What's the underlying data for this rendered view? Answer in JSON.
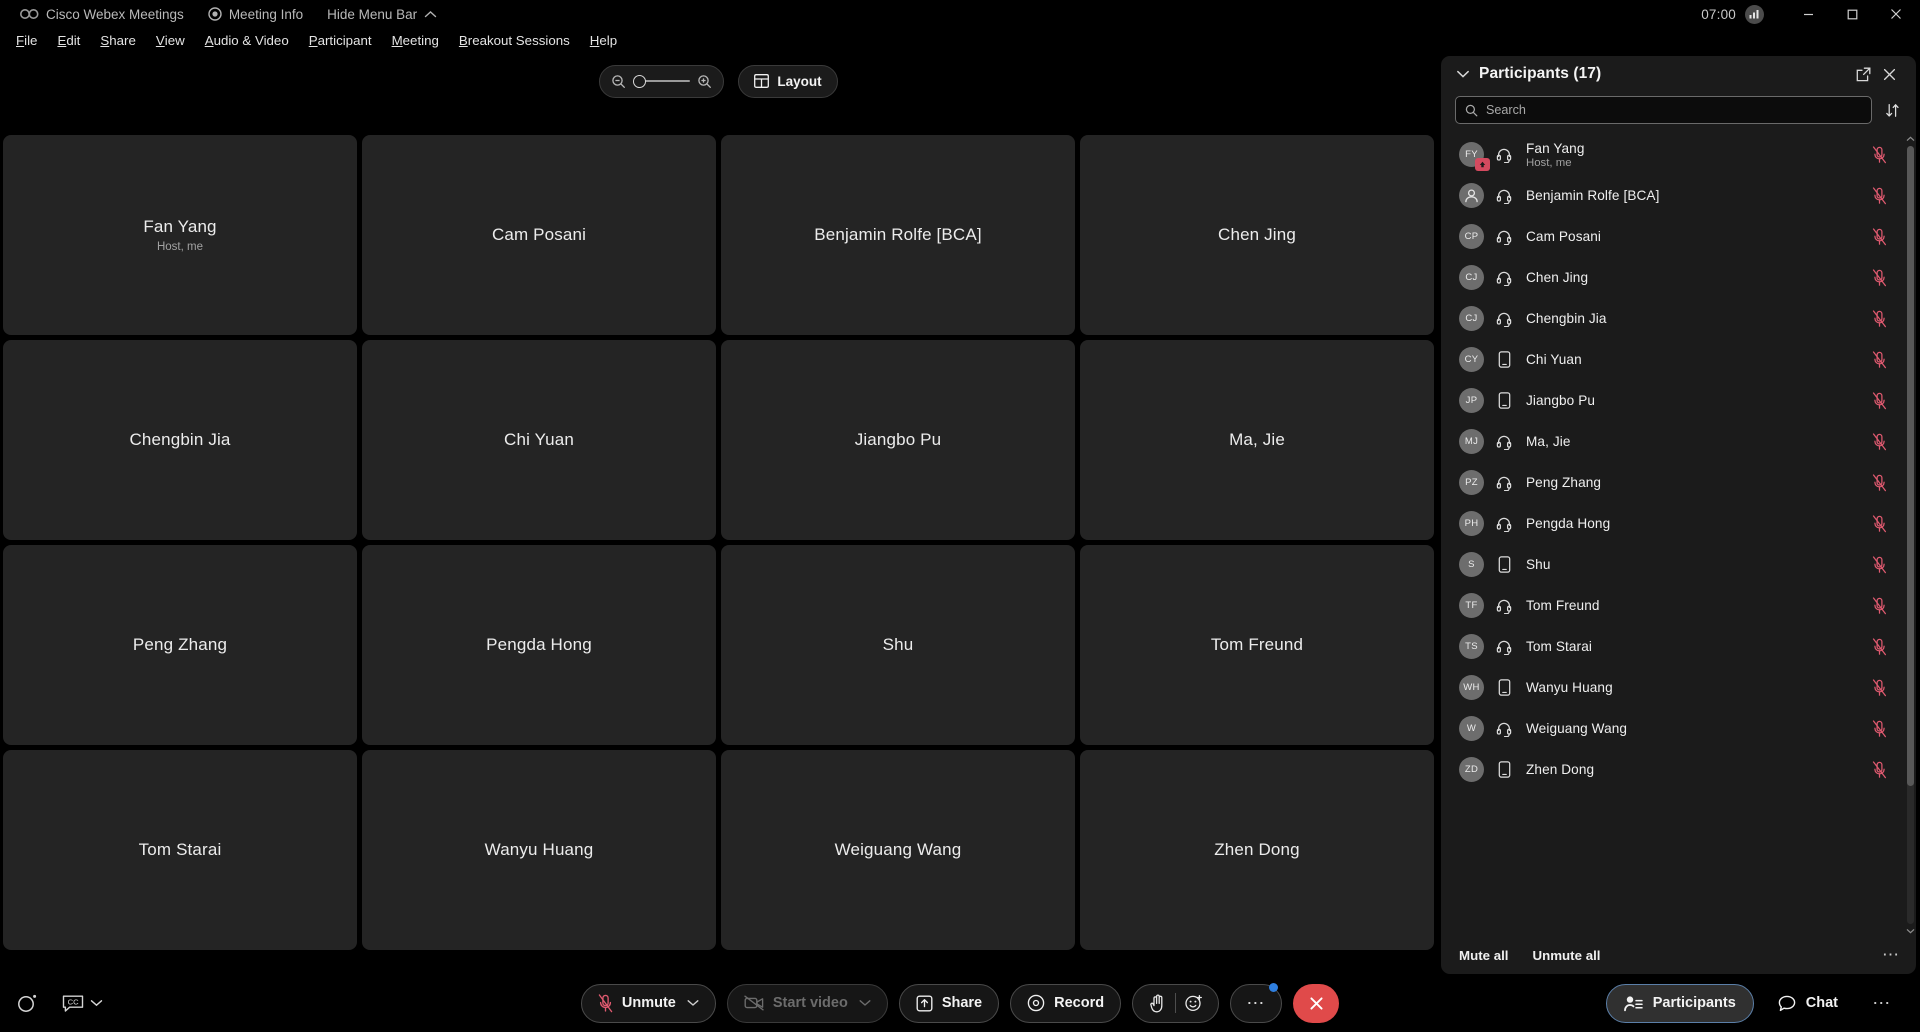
{
  "titlebar": {
    "app_name": "Cisco Webex Meetings",
    "meeting_info": "Meeting Info",
    "hide_menu_bar": "Hide Menu Bar",
    "clock": "07:00",
    "logo_icon": "webex-logo-icon",
    "meeting_info_icon": "info-shield-icon",
    "hide_menu_chevron_icon": "chevron-up-icon",
    "network_icon": "signal-bars-icon",
    "minimize_icon": "minimize-icon",
    "maximize_icon": "maximize-icon",
    "close_icon": "close-icon"
  },
  "menubar": {
    "items": [
      {
        "label": "File",
        "accesskey": "F"
      },
      {
        "label": "Edit",
        "accesskey": "E"
      },
      {
        "label": "Share",
        "accesskey": "S"
      },
      {
        "label": "View",
        "accesskey": "V"
      },
      {
        "label": "Audio & Video",
        "accesskey": "A"
      },
      {
        "label": "Participant",
        "accesskey": "P"
      },
      {
        "label": "Meeting",
        "accesskey": "M"
      },
      {
        "label": "Breakout Sessions",
        "accesskey": "B"
      },
      {
        "label": "Help",
        "accesskey": "H"
      }
    ]
  },
  "stage_top": {
    "zoom_out_icon": "zoom-out-icon",
    "zoom_in_icon": "zoom-in-icon",
    "zoom_level_percent": 0,
    "layout_label": "Layout",
    "layout_icon": "grid-layout-icon"
  },
  "grid": {
    "tiles": [
      {
        "name": "Fan Yang",
        "sub": "Host, me"
      },
      {
        "name": "Cam Posani",
        "sub": ""
      },
      {
        "name": "Benjamin Rolfe [BCA]",
        "sub": ""
      },
      {
        "name": "Chen Jing",
        "sub": ""
      },
      {
        "name": "Chengbin Jia",
        "sub": ""
      },
      {
        "name": "Chi Yuan",
        "sub": ""
      },
      {
        "name": "Jiangbo Pu",
        "sub": ""
      },
      {
        "name": "Ma, Jie",
        "sub": ""
      },
      {
        "name": "Peng Zhang",
        "sub": ""
      },
      {
        "name": "Pengda Hong",
        "sub": ""
      },
      {
        "name": "Shu",
        "sub": ""
      },
      {
        "name": "Tom Freund",
        "sub": ""
      },
      {
        "name": "Tom Starai",
        "sub": ""
      },
      {
        "name": "Wanyu Huang",
        "sub": ""
      },
      {
        "name": "Weiguang Wang",
        "sub": ""
      },
      {
        "name": "Zhen Dong",
        "sub": ""
      }
    ]
  },
  "panel": {
    "title": "Participants (17)",
    "collapse_icon": "chevron-down-icon",
    "popout_icon": "open-in-new-window-icon",
    "close_icon": "close-icon",
    "search": {
      "placeholder": "Search",
      "value": "",
      "icon": "search-icon"
    },
    "sort_icon": "sort-arrows-icon",
    "mute_all_label": "Mute all",
    "unmute_all_label": "Unmute all",
    "more_icon": "more-horizontal-icon",
    "scroll_up_icon": "chevron-up-icon",
    "scroll_down_icon": "chevron-down-icon",
    "participants": [
      {
        "initials": "FY",
        "name": "Fan Yang",
        "sub": "Host, me",
        "device": "headset",
        "muted": true,
        "host": true
      },
      {
        "initials": "",
        "name": "Benjamin Rolfe [BCA]",
        "sub": "",
        "device": "headset",
        "muted": true,
        "host": false,
        "avatar_icon": "person-icon"
      },
      {
        "initials": "CP",
        "name": "Cam Posani",
        "sub": "",
        "device": "headset",
        "muted": true,
        "host": false
      },
      {
        "initials": "CJ",
        "name": "Chen Jing",
        "sub": "",
        "device": "headset",
        "muted": true,
        "host": false
      },
      {
        "initials": "CJ",
        "name": "Chengbin Jia",
        "sub": "",
        "device": "headset",
        "muted": true,
        "host": false
      },
      {
        "initials": "CY",
        "name": "Chi Yuan",
        "sub": "",
        "device": "mobile",
        "muted": true,
        "host": false
      },
      {
        "initials": "JP",
        "name": "Jiangbo Pu",
        "sub": "",
        "device": "mobile",
        "muted": true,
        "host": false
      },
      {
        "initials": "MJ",
        "name": "Ma, Jie",
        "sub": "",
        "device": "headset",
        "muted": true,
        "host": false
      },
      {
        "initials": "PZ",
        "name": "Peng Zhang",
        "sub": "",
        "device": "headset",
        "muted": true,
        "host": false
      },
      {
        "initials": "PH",
        "name": "Pengda Hong",
        "sub": "",
        "device": "headset",
        "muted": true,
        "host": false
      },
      {
        "initials": "S",
        "name": "Shu",
        "sub": "",
        "device": "mobile",
        "muted": true,
        "host": false
      },
      {
        "initials": "TF",
        "name": "Tom Freund",
        "sub": "",
        "device": "headset",
        "muted": true,
        "host": false
      },
      {
        "initials": "TS",
        "name": "Tom Starai",
        "sub": "",
        "device": "headset",
        "muted": true,
        "host": false
      },
      {
        "initials": "WH",
        "name": "Wanyu Huang",
        "sub": "",
        "device": "mobile",
        "muted": true,
        "host": false
      },
      {
        "initials": "W",
        "name": "Weiguang Wang",
        "sub": "",
        "device": "headset",
        "muted": true,
        "host": false
      },
      {
        "initials": "ZD",
        "name": "Zhen Dong",
        "sub": "",
        "device": "mobile",
        "muted": true,
        "host": false
      }
    ]
  },
  "bottombar": {
    "connection_icon": "connection-circle-icon",
    "cc_icon": "closed-captions-icon",
    "cc_caret_icon": "chevron-down-icon",
    "unmute_label": "Unmute",
    "unmute_icon": "mic-muted-icon",
    "start_video_label": "Start video",
    "start_video_icon": "camera-off-icon",
    "share_label": "Share",
    "share_icon": "share-screen-icon",
    "record_label": "Record",
    "record_icon": "record-circle-icon",
    "raise_hand_icon": "raise-hand-icon",
    "reactions_icon": "reaction-smiley-icon",
    "more_icon": "more-horizontal-icon",
    "end_icon": "end-meeting-x-icon",
    "participants_label": "Participants",
    "participants_icon": "participants-icon",
    "chat_label": "Chat",
    "chat_icon": "chat-bubble-icon",
    "right_more_icon": "more-horizontal-icon"
  },
  "colors": {
    "panel_bg": "#1b1b1b",
    "tile_bg": "#242424",
    "muted_red": "#e05a70",
    "end_red": "#e04a4a",
    "accent_blue": "#2f7fe0"
  }
}
